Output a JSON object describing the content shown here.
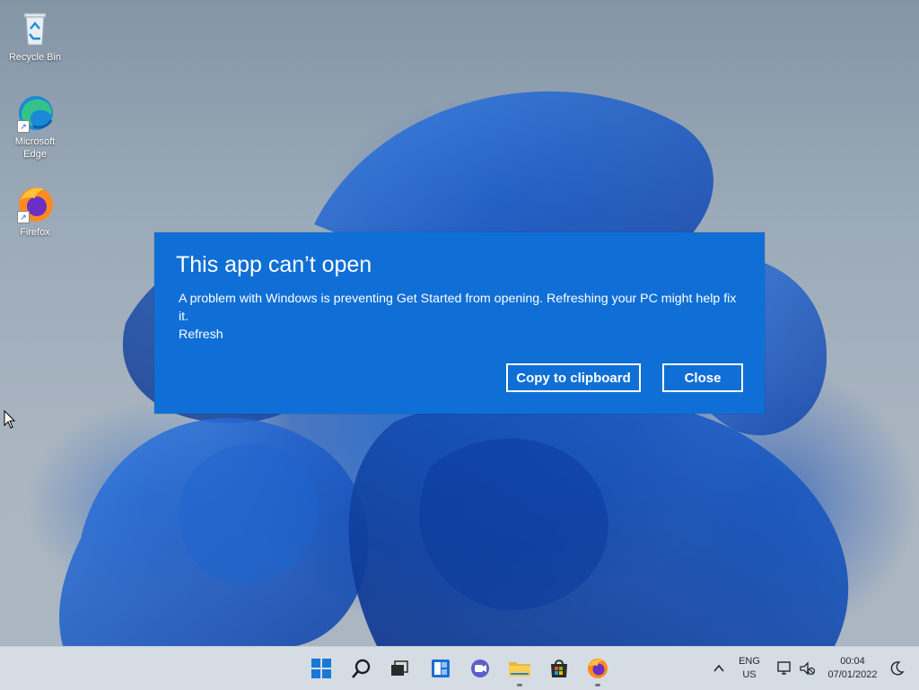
{
  "desktop": {
    "icons": [
      {
        "label": "Recycle Bin",
        "icon": "recycle-bin-icon"
      },
      {
        "label": "Microsoft Edge",
        "label_line1": "Microsoft",
        "label_line2": "Edge",
        "icon": "edge-icon"
      },
      {
        "label": "Firefox",
        "icon": "firefox-icon"
      }
    ]
  },
  "dialog": {
    "title": "This app can’t open",
    "message": "A problem with Windows is preventing Get Started from opening. Refreshing your PC might help fix it.",
    "link": "Refresh",
    "copy_button": "Copy to clipboard",
    "close_button": "Close",
    "background_color": "#0f6fd6"
  },
  "taskbar": {
    "pinned": [
      "start-icon",
      "search-icon",
      "task-view-icon",
      "widgets-icon",
      "chat-icon",
      "file-explorer-icon",
      "store-icon",
      "firefox-icon"
    ],
    "tray": {
      "language_line1": "ENG",
      "language_line2": "US",
      "time": "00:04",
      "date": "07/01/2022"
    }
  }
}
